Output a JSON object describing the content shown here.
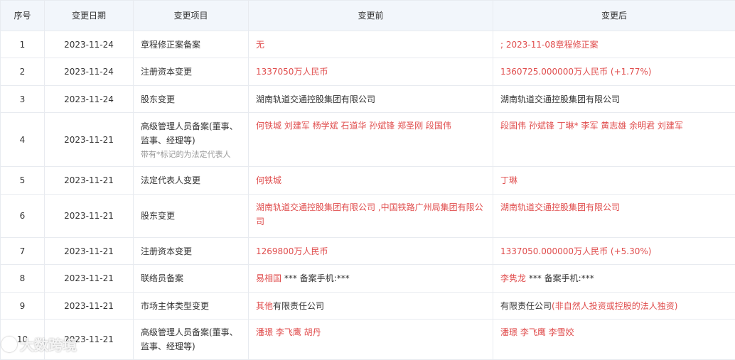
{
  "headers": {
    "seq": "序号",
    "date": "变更日期",
    "item": "变更项目",
    "before": "变更前",
    "after": "变更后"
  },
  "rows": [
    {
      "seq": "1",
      "date": "2023-11-24",
      "item": "章程修正案备案",
      "note": "",
      "before": [
        {
          "t": "无",
          "red": true
        }
      ],
      "after": [
        {
          "t": "; 2023-11-08章程修正案",
          "red": true
        }
      ]
    },
    {
      "seq": "2",
      "date": "2023-11-24",
      "item": "注册资本变更",
      "note": "",
      "before": [
        {
          "t": "1337050万人民币",
          "red": true
        }
      ],
      "after": [
        {
          "t": "1360725.000000万人民币 (+1.77%)",
          "red": true
        }
      ]
    },
    {
      "seq": "3",
      "date": "2023-11-24",
      "item": "股东变更",
      "note": "",
      "before": [
        {
          "t": "湖南轨道交通控股集团有限公司",
          "red": false
        }
      ],
      "after": [
        {
          "t": "湖南轨道交通控股集团有限公司",
          "red": false
        }
      ]
    },
    {
      "seq": "4",
      "date": "2023-11-21",
      "item": "高级管理人员备案(董事、监事、经理等)",
      "note": "带有*标记的为法定代表人",
      "before": [
        {
          "t": "何铁城 刘建军 杨学斌 石道华 孙斌锋 郑圣刚 段国伟",
          "red": true
        }
      ],
      "after": [
        {
          "t": "段国伟 孙斌锋 丁琳* 李军 黄志雄 余明君 刘建军",
          "red": true
        }
      ]
    },
    {
      "seq": "5",
      "date": "2023-11-21",
      "item": "法定代表人变更",
      "note": "",
      "before": [
        {
          "t": "何铁城",
          "red": true
        }
      ],
      "after": [
        {
          "t": "丁琳",
          "red": true
        }
      ]
    },
    {
      "seq": "6",
      "date": "2023-11-21",
      "item": "股东变更",
      "note": "",
      "before": [
        {
          "t": "湖南轨道交通控股集团有限公司 ,中国铁路广州局集团有限公司",
          "red": true
        }
      ],
      "after": [
        {
          "t": "湖南轨道交通控股集团有限公司",
          "red": true
        }
      ]
    },
    {
      "seq": "7",
      "date": "2023-11-21",
      "item": "注册资本变更",
      "note": "",
      "before": [
        {
          "t": "1269800万人民币",
          "red": true
        }
      ],
      "after": [
        {
          "t": "1337050.000000万人民币 (+5.30%)",
          "red": true
        }
      ]
    },
    {
      "seq": "8",
      "date": "2023-11-21",
      "item": "联络员备案",
      "note": "",
      "before": [
        {
          "t": "易相国",
          "red": true
        },
        {
          "t": " *** 备案手机:***",
          "red": false
        }
      ],
      "after": [
        {
          "t": "李隽龙",
          "red": true
        },
        {
          "t": " *** 备案手机:***",
          "red": false
        }
      ]
    },
    {
      "seq": "9",
      "date": "2023-11-21",
      "item": "市场主体类型变更",
      "note": "",
      "before": [
        {
          "t": "其他",
          "red": true
        },
        {
          "t": "有限责任公司",
          "red": false
        }
      ],
      "after": [
        {
          "t": "有限责任公司",
          "red": false
        },
        {
          "t": "(非自然人投资或控股的法人独资)",
          "red": true
        }
      ]
    },
    {
      "seq": "10",
      "date": "2023-11-21",
      "item": "高级管理人员备案(董事、监事、经理等)",
      "note": "",
      "before": [
        {
          "t": "潘璟 李飞鹰 胡丹",
          "red": true
        }
      ],
      "after": [
        {
          "t": "潘璟 李飞鹰 李雪姣",
          "red": true
        }
      ]
    }
  ],
  "watermark": "大数跨境",
  "colors": {
    "highlight": "#e04d4d",
    "header_bg": "#f2f6fb",
    "border": "#e8ebf0"
  }
}
